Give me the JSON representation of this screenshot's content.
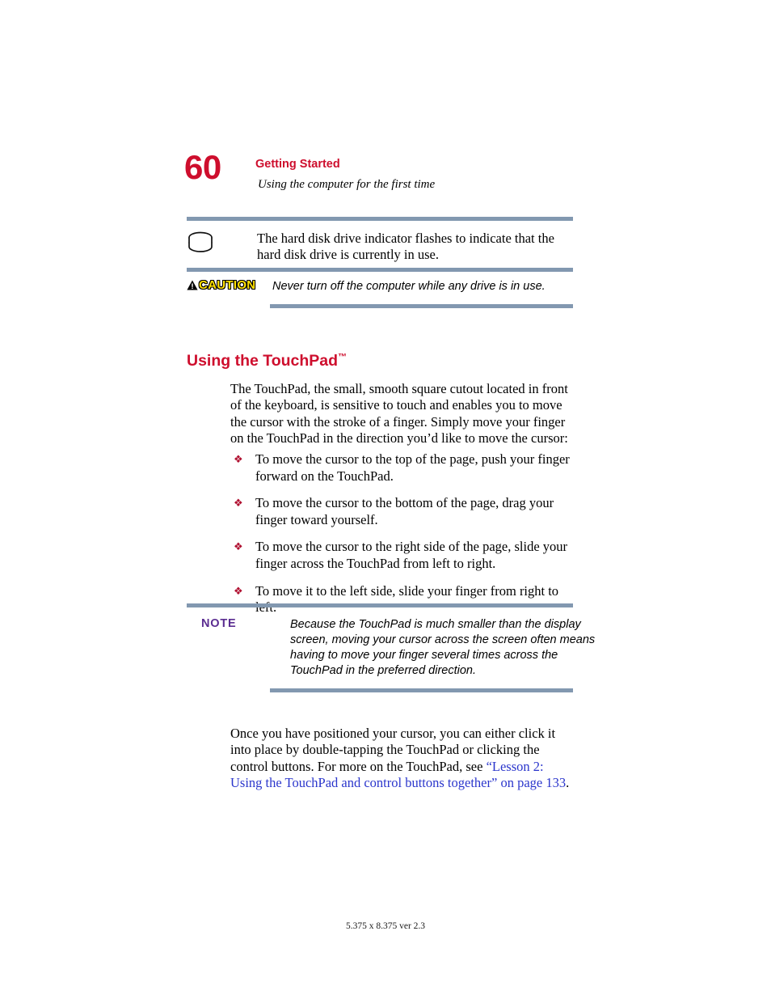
{
  "header": {
    "page_number": "60",
    "chapter_title": "Getting Started",
    "section_subtitle": "Using the computer for the first time"
  },
  "hdd_callout": {
    "icon": "hard-disk-drive-icon",
    "text": "The hard disk drive indicator flashes to indicate that the hard disk drive is currently in use."
  },
  "caution_callout": {
    "label": "CAUTION",
    "icon": "warning-triangle-icon",
    "text": "Never turn off the computer while any drive is in use."
  },
  "section": {
    "heading": "Using the TouchPad",
    "heading_trademark": "™"
  },
  "intro_paragraph": "The TouchPad, the small, smooth square cutout located in front of the keyboard, is sensitive to touch and enables you to move the cursor with the stroke of a finger. Simply move your finger on the TouchPad in the direction you’d like to move the cursor:",
  "bullets": [
    {
      "marker": "❖",
      "text": "To move the cursor to the top of the page, push your finger forward on the TouchPad."
    },
    {
      "marker": "❖",
      "text": "To move the cursor to the bottom of the page, drag your finger toward yourself."
    },
    {
      "marker": "❖",
      "text": "To move the cursor to the right side of the page, slide your finger across the TouchPad from left to right."
    },
    {
      "marker": "❖",
      "text": "To move it to the left side, slide your finger from right to left."
    }
  ],
  "note_callout": {
    "label": "NOTE",
    "text": "Because the TouchPad is much smaller than the display screen, moving your cursor across the screen often means having to move your finger several times across the TouchPad in the preferred direction."
  },
  "closing_paragraph": {
    "before_link": "Once you have positioned your cursor, you can either click it into place by double-tapping the TouchPad or clicking the control buttons. For more on the TouchPad, see ",
    "link_text": "“Lesson 2: Using the TouchPad and control buttons together” on page 133",
    "after_link": "."
  },
  "footer": {
    "text": "5.375 x 8.375 ver 2.3"
  },
  "colors": {
    "accent_red": "#CE0E2D",
    "rule_blue_gray": "#8298B0",
    "note_purple": "#5B2D91",
    "link_blue": "#2B36CC",
    "caution_yellow": "#FFE000",
    "bullet_red": "#B01030"
  }
}
